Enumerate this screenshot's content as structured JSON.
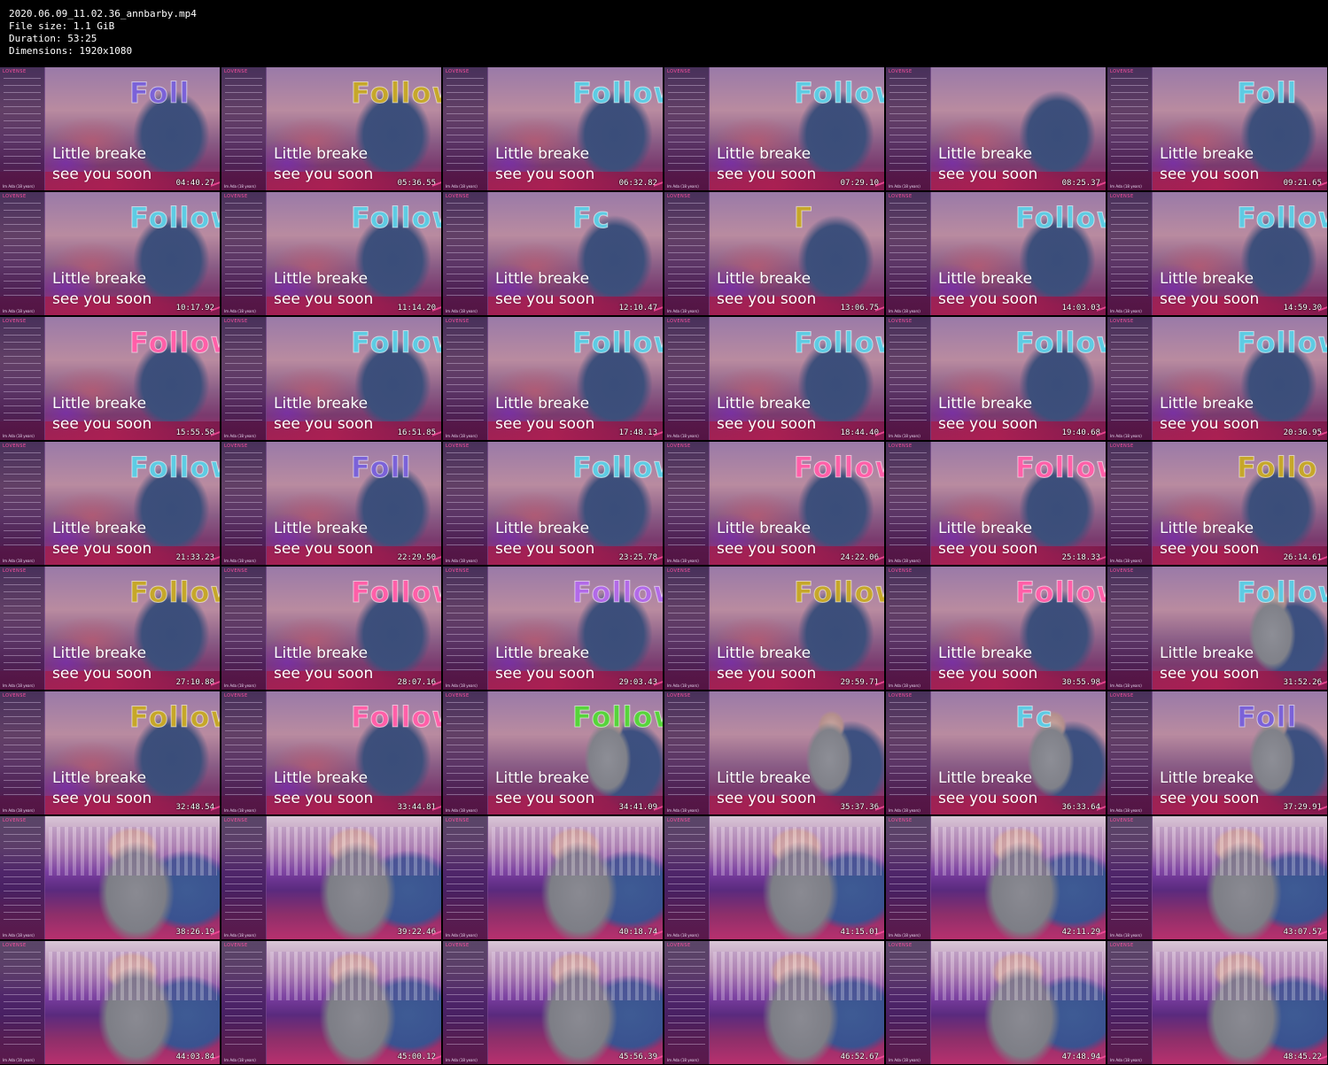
{
  "header": {
    "filename": "2020.06.09_11.02.36_annbarby.mp4",
    "file_size": "File size: 1.1 GiB",
    "duration": "Duration: 53:25",
    "dimensions": "Dimensions: 1920x1080"
  },
  "panel": {
    "logo": "LOVENSE",
    "footer": "Im Ada (18 years)"
  },
  "overlay_message": {
    "line1": "Little breake",
    "line2": "see you soon"
  },
  "colors": {
    "follow_blue": "#5ecbe3",
    "follow_purple": "#7b62d8",
    "follow_gold": "#c6a72a",
    "follow_pink": "#ff5fa8",
    "follow_green": "#57d43b",
    "follow_violet": "#b26ae8"
  },
  "thumbnails": [
    {
      "timestamp": "04:40.27",
      "scene": "break",
      "follow": "Foll",
      "follow_color": "#7b62d8"
    },
    {
      "timestamp": "05:36.55",
      "scene": "break",
      "follow": "Follow",
      "follow_color": "#c6a72a"
    },
    {
      "timestamp": "06:32.82",
      "scene": "break",
      "follow": "Follow",
      "follow_color": "#5ecbe3"
    },
    {
      "timestamp": "07:29.10",
      "scene": "break",
      "follow": "Follow",
      "follow_color": "#5ecbe3"
    },
    {
      "timestamp": "08:25.37",
      "scene": "break",
      "follow": "",
      "follow_color": "#5ecbe3"
    },
    {
      "timestamp": "09:21.65",
      "scene": "break",
      "follow": "Foll",
      "follow_color": "#5ecbe3"
    },
    {
      "timestamp": "10:17.92",
      "scene": "break",
      "follow": "Follow",
      "follow_color": "#5ecbe3"
    },
    {
      "timestamp": "11:14.20",
      "scene": "break",
      "follow": "Follow",
      "follow_color": "#5ecbe3"
    },
    {
      "timestamp": "12:10.47",
      "scene": "break",
      "follow": "Fc",
      "follow_color": "#5ecbe3"
    },
    {
      "timestamp": "13:06.75",
      "scene": "break",
      "follow": "Г",
      "follow_color": "#c6a72a"
    },
    {
      "timestamp": "14:03.03",
      "scene": "break",
      "follow": "Follow",
      "follow_color": "#5ecbe3"
    },
    {
      "timestamp": "14:59.30",
      "scene": "break",
      "follow": "Follow",
      "follow_color": "#5ecbe3"
    },
    {
      "timestamp": "15:55.58",
      "scene": "break",
      "follow": "Follow",
      "follow_color": "#ff5fa8"
    },
    {
      "timestamp": "16:51.85",
      "scene": "break",
      "follow": "Follow",
      "follow_color": "#5ecbe3"
    },
    {
      "timestamp": "17:48.13",
      "scene": "break",
      "follow": "Follow",
      "follow_color": "#5ecbe3"
    },
    {
      "timestamp": "18:44.40",
      "scene": "break",
      "follow": "Follow",
      "follow_color": "#5ecbe3"
    },
    {
      "timestamp": "19:40.68",
      "scene": "break",
      "follow": "Follow",
      "follow_color": "#5ecbe3"
    },
    {
      "timestamp": "20:36.95",
      "scene": "break",
      "follow": "Follow",
      "follow_color": "#5ecbe3"
    },
    {
      "timestamp": "21:33.23",
      "scene": "break",
      "follow": "Follow",
      "follow_color": "#5ecbe3"
    },
    {
      "timestamp": "22:29.50",
      "scene": "break",
      "follow": "Foll",
      "follow_color": "#7b62d8"
    },
    {
      "timestamp": "23:25.78",
      "scene": "break",
      "follow": "Follow",
      "follow_color": "#5ecbe3"
    },
    {
      "timestamp": "24:22.06",
      "scene": "break",
      "follow": "Follow",
      "follow_color": "#ff5fa8"
    },
    {
      "timestamp": "25:18.33",
      "scene": "break",
      "follow": "Follow",
      "follow_color": "#ff5fa8"
    },
    {
      "timestamp": "26:14.61",
      "scene": "break",
      "follow": "Follo",
      "follow_color": "#c6a72a"
    },
    {
      "timestamp": "27:10.88",
      "scene": "break",
      "follow": "Follow",
      "follow_color": "#c6a72a"
    },
    {
      "timestamp": "28:07.16",
      "scene": "break",
      "follow": "Follow",
      "follow_color": "#ff5fa8"
    },
    {
      "timestamp": "29:03.43",
      "scene": "break",
      "follow": "Follow",
      "follow_color": "#b26ae8"
    },
    {
      "timestamp": "29:59.71",
      "scene": "break",
      "follow": "Follow",
      "follow_color": "#c6a72a"
    },
    {
      "timestamp": "30:55.98",
      "scene": "break",
      "follow": "Follow",
      "follow_color": "#ff5fa8"
    },
    {
      "timestamp": "31:52.26",
      "scene": "transition",
      "follow": "Follow",
      "follow_color": "#5ecbe3"
    },
    {
      "timestamp": "32:48.54",
      "scene": "break",
      "follow": "Follow",
      "follow_color": "#c6a72a"
    },
    {
      "timestamp": "33:44.81",
      "scene": "break",
      "follow": "Follow",
      "follow_color": "#ff5fa8"
    },
    {
      "timestamp": "34:41.09",
      "scene": "transition",
      "follow": "Follow",
      "follow_color": "#57d43b"
    },
    {
      "timestamp": "35:37.36",
      "scene": "transition",
      "follow": "",
      "follow_color": "#5ecbe3"
    },
    {
      "timestamp": "36:33.64",
      "scene": "transition",
      "follow": "Fc",
      "follow_color": "#5ecbe3"
    },
    {
      "timestamp": "37:29.91",
      "scene": "transition",
      "follow": "Foll",
      "follow_color": "#7b62d8"
    },
    {
      "timestamp": "38:26.19",
      "scene": "live",
      "follow": "",
      "follow_color": ""
    },
    {
      "timestamp": "39:22.46",
      "scene": "live",
      "follow": "",
      "follow_color": ""
    },
    {
      "timestamp": "40:18.74",
      "scene": "live",
      "follow": "",
      "follow_color": ""
    },
    {
      "timestamp": "41:15.01",
      "scene": "live",
      "follow": "",
      "follow_color": ""
    },
    {
      "timestamp": "42:11.29",
      "scene": "live",
      "follow": "",
      "follow_color": ""
    },
    {
      "timestamp": "43:07.57",
      "scene": "live",
      "follow": "",
      "follow_color": ""
    },
    {
      "timestamp": "44:03.84",
      "scene": "live",
      "follow": "",
      "follow_color": ""
    },
    {
      "timestamp": "45:00.12",
      "scene": "live",
      "follow": "",
      "follow_color": ""
    },
    {
      "timestamp": "45:56.39",
      "scene": "live",
      "follow": "",
      "follow_color": ""
    },
    {
      "timestamp": "46:52.67",
      "scene": "live",
      "follow": "",
      "follow_color": ""
    },
    {
      "timestamp": "47:48.94",
      "scene": "live",
      "follow": "",
      "follow_color": ""
    },
    {
      "timestamp": "48:45.22",
      "scene": "live",
      "follow": "",
      "follow_color": ""
    }
  ]
}
